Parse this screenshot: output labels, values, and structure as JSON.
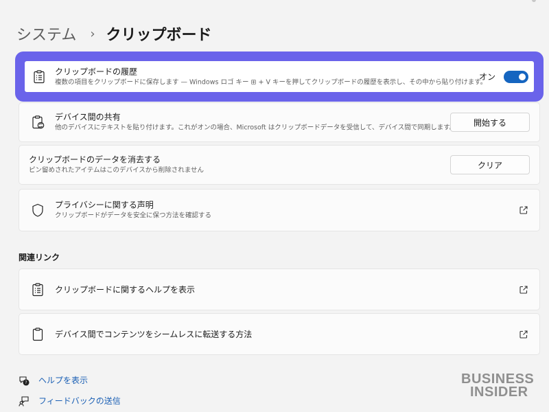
{
  "breadcrumb": {
    "parent": "システム",
    "separator": "›",
    "current": "クリップボード"
  },
  "clipboard_history": {
    "title": "クリップボードの履歴",
    "description": "複数の項目をクリップボードに保存します — Windows ロゴ キー ⊞ + V キーを押してクリップボードの履歴を表示し、その中から貼り付けます。",
    "toggle_label": "オン",
    "toggle_on": true,
    "icon": "clipboard-list-icon"
  },
  "cross_device": {
    "title": "デバイス間の共有",
    "description": "他のデバイスにテキストを貼り付けます。これがオンの場合、Microsoft はクリップボードデータを受信して、デバイス間で同期します。",
    "button_label": "開始する",
    "icon": "clipboard-sync-icon"
  },
  "clear_data": {
    "title": "クリップボードのデータを消去する",
    "description": "ピン留めされたアイテムはこのデバイスから削除されません",
    "button_label": "クリア"
  },
  "privacy": {
    "title": "プライバシーに関する声明",
    "description": "クリップボードがデータを安全に保つ方法を確認する",
    "icon": "shield-icon"
  },
  "related_links": {
    "heading": "関連リンク",
    "items": [
      {
        "label": "クリップボードに関するヘルプを表示",
        "icon": "clipboard-list-icon"
      },
      {
        "label": "デバイス間でコンテンツをシームレスに転送する方法",
        "icon": "clipboard-icon"
      }
    ]
  },
  "footer": {
    "help_label": "ヘルプを表示",
    "feedback_label": "フィードバックの送信"
  },
  "watermark": {
    "line1": "BUSINESS",
    "line2": "INSIDER"
  },
  "colors": {
    "highlight": "#6a63ea",
    "toggle_on": "#1565c0",
    "link": "#1a5fb4"
  }
}
